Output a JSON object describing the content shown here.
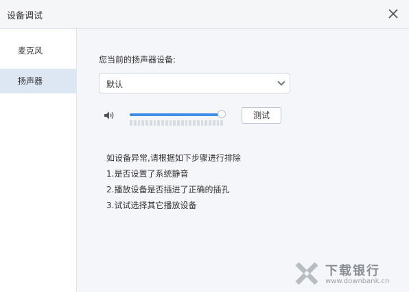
{
  "window": {
    "title": "设备调试"
  },
  "sidebar": {
    "items": [
      {
        "label": "麦克风",
        "active": false
      },
      {
        "label": "扬声器",
        "active": true
      }
    ]
  },
  "speaker": {
    "label": "您当前的扬声器设备:",
    "device_value": "默认",
    "volume_percent": 100,
    "test_label": "测试"
  },
  "tips": [
    "如设备异常,请根据如下步骤进行排除",
    "1.是否设置了系统静音",
    "2.播放设备是否插进了正确的插孔",
    "3.试试选择其它播放设备"
  ],
  "watermark": {
    "name": "下载银行",
    "url": "www.downbank.cn"
  },
  "colors": {
    "accent": "#3d8ee6",
    "active_bg": "#dde7f3",
    "background": "#f4f6f9"
  }
}
